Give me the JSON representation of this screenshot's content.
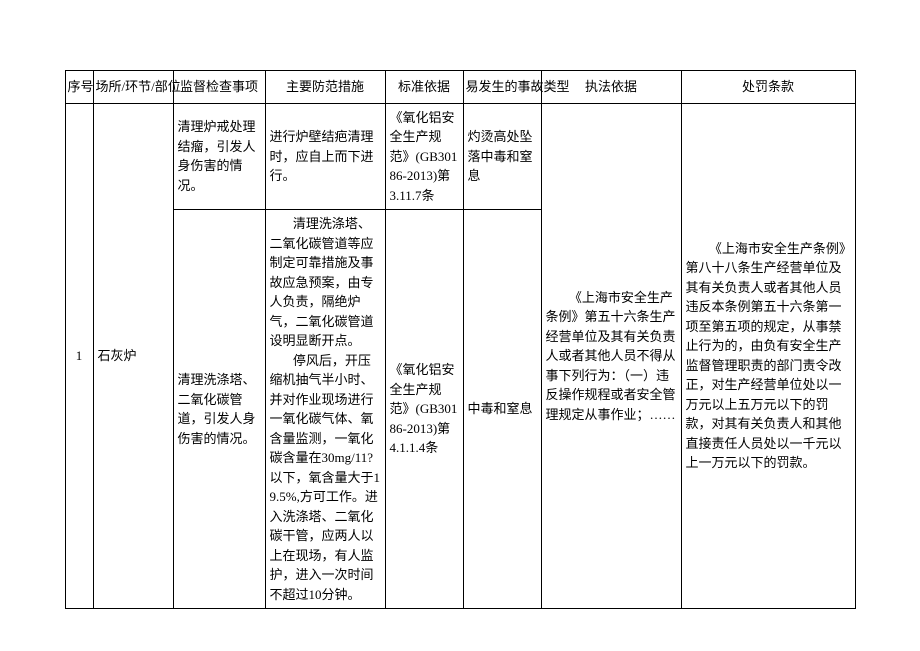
{
  "headers": {
    "seq": "序号",
    "place": "场所/环节/部位",
    "item": "监督检查事项",
    "measure": "主要防范措施",
    "standard": "标准依据",
    "accident": "易发生的事故类型",
    "law": "执法依据",
    "penalty": "处罚条款"
  },
  "rows": {
    "seq": "1",
    "place": "石灰炉",
    "r1": {
      "item": "清理炉戒处理结瘤，引发人身伤害的情况。",
      "measure": "进行炉壁结疤清理时，应自上而下进行。",
      "standard": "《氧化铝安全生产规范》(GB30186-2013)第3.11.7条",
      "accident": "灼烫高处坠落中毒和窒息"
    },
    "r2": {
      "item": "清理洗涤塔、二氧化碳管道，引发人身伤害的情况。",
      "measure_p1": "清理洗涤塔、二氧化碳管道等应制定可靠措施及事故应急预案，由专人负责，隔绝炉气，二氧化碳管道设明显断开点。",
      "measure_p2": "停风后，开压缩机抽气半小时、并对作业现场进行一氧化碳气体、氧含量监测，一氧化碳含量在30mg/11?以下，氧含量大于19.5%,方可工作。进入洗涤塔、二氧化碳干管，应两人以上在现场，有人监护，进入一次时间不超过10分钟。",
      "standard": "《氧化铝安全生产规范》(GB30186-2013)第4.1.1.4条",
      "accident": "中毒和窒息"
    },
    "law": "《上海市安全生产条例》第五十六条生产经营单位及其有关负责人或者其他人员不得从事下列行为：（一）违反操作规程或者安全管理规定从事作业；……",
    "penalty": "《上海市安全生产条例》第八十八条生产经营单位及其有关负责人或者其他人员违反本条例第五十六条第一项至第五项的规定，从事禁止行为的，由负有安全生产监督管理职责的部门责令改正，对生产经营单位处以一万元以上五万元以下的罚款，对其有关负责人和其他直接责任人员处以一千元以上一万元以下的罚款。"
  }
}
